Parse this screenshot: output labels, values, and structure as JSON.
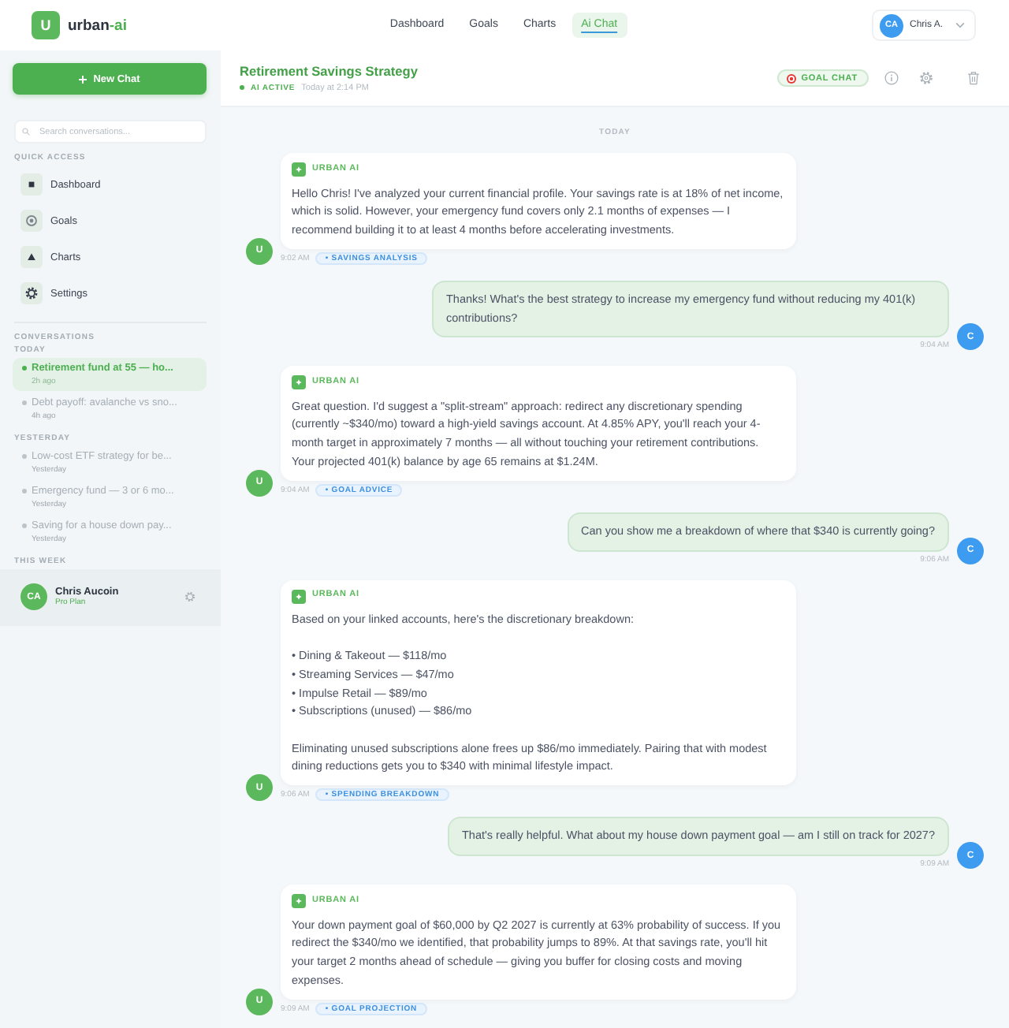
{
  "top_bar": {
    "logo": {
      "mark": "U",
      "name": "urban",
      "accent": "-ai"
    },
    "nav": [
      {
        "label": "Dashboard",
        "selected": false
      },
      {
        "label": "Goals",
        "selected": false
      },
      {
        "label": "Charts",
        "selected": false
      },
      {
        "label": "Ai Chat",
        "selected": true
      }
    ],
    "user": {
      "initials": "CA",
      "name": "Chris A."
    }
  },
  "sidebar": {
    "new_chat": {
      "label": "New Chat"
    },
    "search": {
      "placeholder": "Search conversations..."
    },
    "quick_access": {
      "heading": "QUICK ACCESS",
      "items": [
        {
          "label": "Dashboard",
          "kind": "dashboard"
        },
        {
          "label": "Goals",
          "kind": "goals"
        },
        {
          "label": "Charts",
          "kind": "charts"
        },
        {
          "label": "Settings",
          "kind": "settings"
        }
      ]
    },
    "conversations": {
      "heading": "CONVERSATIONS",
      "groups": [
        {
          "label": "TODAY",
          "items": [
            {
              "title": "Retirement fund at 55 — ho...",
              "time": "2h ago",
              "selected": true
            },
            {
              "title": "Debt payoff: avalanche vs sno...",
              "time": "4h ago",
              "selected": false
            }
          ]
        },
        {
          "label": "YESTERDAY",
          "items": [
            {
              "title": "Low-cost ETF strategy for be...",
              "time": "Yesterday",
              "selected": false
            },
            {
              "title": "Emergency fund — 3 or 6 mo...",
              "time": "Yesterday",
              "selected": false
            },
            {
              "title": "Saving for a house down pay...",
              "time": "Yesterday",
              "selected": false
            }
          ]
        },
        {
          "label": "THIS WEEK"
        }
      ]
    },
    "user_card": {
      "initials": "CA",
      "name": "Chris Aucoin",
      "plan": "Pro Plan"
    }
  },
  "chat": {
    "header": {
      "title": "Retirement Savings Strategy",
      "status": "AI ACTIVE",
      "timestamp": "Today at 2:14 PM",
      "badge": "GOAL CHAT"
    },
    "day_label": "TODAY",
    "messages": [
      {
        "kind": "ai",
        "avatar": "U",
        "sender": "URBAN AI",
        "blocks": [
          {
            "kind": "text",
            "text": "Hello Chris! I've analyzed your current financial profile. Your savings rate is at 18% of net income, which is solid. However, your emergency fund covers only 2.1 months of expenses — I recommend building it to at least 4 months before accelerating investments."
          }
        ],
        "time": "9:02 AM",
        "tag": "• SAVINGS ANALYSIS"
      },
      {
        "kind": "user",
        "avatar": "C",
        "blocks": [
          {
            "kind": "text",
            "text": "Thanks! What's the best strategy to increase my emergency fund without reducing my 401(k) contributions?"
          }
        ],
        "time": "9:04 AM"
      },
      {
        "kind": "ai",
        "avatar": "U",
        "sender": "URBAN AI",
        "blocks": [
          {
            "kind": "text",
            "text": "Great question. I'd suggest a \"split-stream\" approach: redirect any discretionary spending (currently ~$340/mo) toward a high-yield savings account. At 4.85% APY, you'll reach your 4-month target in approximately 7 months — all without touching your retirement contributions. Your projected 401(k) balance by age 65 remains at $1.24M."
          }
        ],
        "time": "9:04 AM",
        "tag": "• GOAL ADVICE"
      },
      {
        "kind": "user",
        "avatar": "C",
        "blocks": [
          {
            "kind": "text",
            "text": "Can you show me a breakdown of where that $340 is currently going?"
          }
        ],
        "time": "9:06 AM"
      },
      {
        "kind": "ai",
        "avatar": "U",
        "sender": "URBAN AI",
        "blocks": [
          {
            "kind": "text",
            "text": "Based on your linked accounts, here's the discretionary breakdown:"
          },
          {
            "kind": "list",
            "items": [
              "• Dining & Takeout — $118/mo",
              "• Streaming Services — $47/mo",
              "• Impulse Retail — $89/mo",
              "• Subscriptions (unused) — $86/mo"
            ]
          },
          {
            "kind": "text",
            "text": "Eliminating unused subscriptions alone frees up $86/mo immediately. Pairing that with modest dining reductions gets you to $340 with minimal lifestyle impact."
          }
        ],
        "time": "9:06 AM",
        "tag": "• SPENDING BREAKDOWN"
      },
      {
        "kind": "user",
        "avatar": "C",
        "blocks": [
          {
            "kind": "text",
            "text": "That's really helpful. What about my house down payment goal — am I still on track for 2027?"
          }
        ],
        "time": "9:09 AM"
      },
      {
        "kind": "ai",
        "avatar": "U",
        "sender": "URBAN AI",
        "blocks": [
          {
            "kind": "text",
            "text": "Your down payment goal of $60,000 by Q2 2027 is currently at 63% probability of success. If you redirect the $340/mo we identified, that probability jumps to 89%. At that savings rate, you'll hit your target 2 months ahead of schedule — giving you buffer for closing costs and moving expenses."
          }
        ],
        "time": "9:09 AM",
        "tag": "• GOAL PROJECTION"
      }
    ]
  }
}
